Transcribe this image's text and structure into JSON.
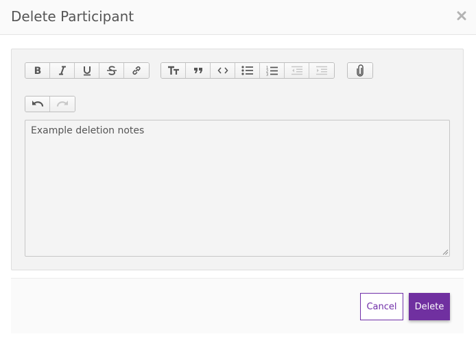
{
  "modal": {
    "title": "Delete Participant",
    "close_icon": "close-icon"
  },
  "toolbar": {
    "groups": [
      [
        "bold-icon",
        "italic-icon",
        "underline-icon",
        "strikethrough-icon",
        "link-icon"
      ],
      [
        "heading-icon",
        "quote-icon",
        "code-icon",
        "bullet-list-icon",
        "numbered-list-icon",
        "outdent-icon",
        "indent-icon"
      ],
      [
        "attach-icon"
      ],
      [
        "undo-icon",
        "redo-icon"
      ]
    ],
    "disabled": [
      "outdent-icon",
      "indent-icon",
      "redo-icon"
    ]
  },
  "editor": {
    "content": "Example deletion notes"
  },
  "footer": {
    "cancel_label": "Cancel",
    "delete_label": "Delete"
  },
  "colors": {
    "accent": "#7030a0",
    "icon": "#555555",
    "icon_disabled": "#c8c8c8"
  }
}
